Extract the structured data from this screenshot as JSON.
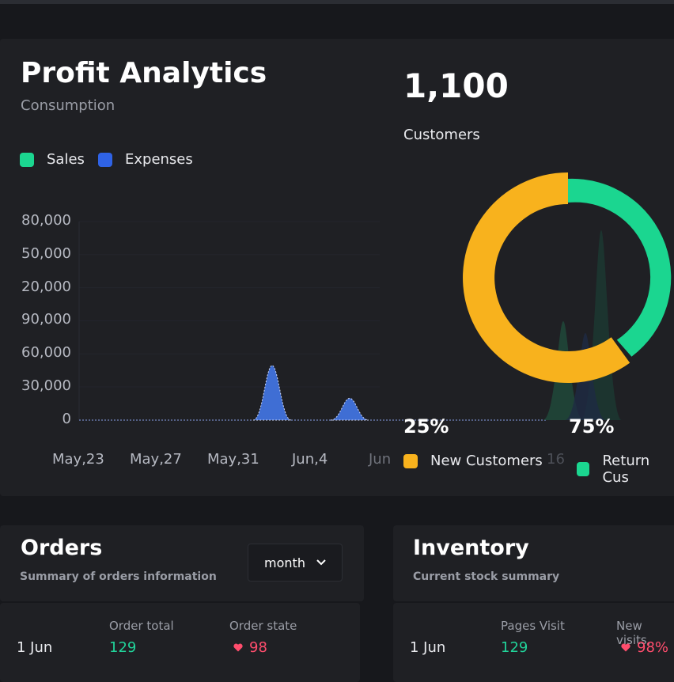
{
  "profit": {
    "title": "Profit Analytics",
    "subtitle": "Consumption",
    "legend": [
      {
        "label": "Sales",
        "color": "#1bd690"
      },
      {
        "label": "Expenses",
        "color": "#2f63e6"
      }
    ]
  },
  "chart_data": {
    "type": "area",
    "categories": [
      "May,23",
      "May,27",
      "May,31",
      "Jun,4",
      "Jun",
      "16"
    ],
    "y_ticks": [
      "80,000",
      "50,000",
      "20,000",
      "90,000",
      "60,000",
      "30,000",
      "0"
    ],
    "series": [
      {
        "name": "Sales",
        "values": [
          0,
          0,
          0,
          0,
          0,
          0
        ]
      },
      {
        "name": "Expenses",
        "values": [
          0,
          0,
          50000,
          20000,
          0,
          0
        ]
      }
    ]
  },
  "customers": {
    "total": "1,100",
    "label": "Customers",
    "segments": [
      {
        "label": "New Customers",
        "percent": "25%",
        "color": "#f8b21d",
        "value": 75
      },
      {
        "label": "Return Cus",
        "percent": "75%",
        "color": "#1bd690",
        "value": 25
      }
    ]
  },
  "orders": {
    "title": "Orders",
    "subtitle": "Summary of orders information",
    "select": "month",
    "col1_label": "Order total",
    "col2_label": "Order state",
    "row": {
      "date": "1 Jun",
      "total": "129",
      "state": "98"
    }
  },
  "inventory": {
    "title": "Inventory",
    "subtitle": "Current stock summary",
    "col1_label": "Pages Visit",
    "col2_label": "New visits,",
    "row": {
      "date": "1 Jun",
      "pages": "129",
      "visits": "98%"
    }
  },
  "colors": {
    "accent_green": "#21d49a",
    "accent_red": "#ff4d6d",
    "accent_orange": "#f8b21d"
  }
}
